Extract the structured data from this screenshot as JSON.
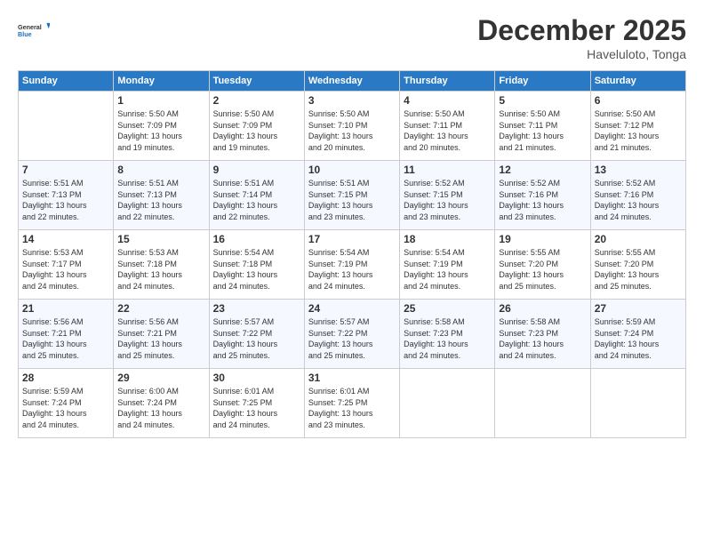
{
  "logo": {
    "text_general": "General",
    "text_blue": "Blue"
  },
  "header": {
    "month_year": "December 2025",
    "location": "Haveluloto, Tonga"
  },
  "days_of_week": [
    "Sunday",
    "Monday",
    "Tuesday",
    "Wednesday",
    "Thursday",
    "Friday",
    "Saturday"
  ],
  "weeks": [
    [
      {
        "day": "",
        "info": ""
      },
      {
        "day": "1",
        "info": "Sunrise: 5:50 AM\nSunset: 7:09 PM\nDaylight: 13 hours\nand 19 minutes."
      },
      {
        "day": "2",
        "info": "Sunrise: 5:50 AM\nSunset: 7:09 PM\nDaylight: 13 hours\nand 19 minutes."
      },
      {
        "day": "3",
        "info": "Sunrise: 5:50 AM\nSunset: 7:10 PM\nDaylight: 13 hours\nand 20 minutes."
      },
      {
        "day": "4",
        "info": "Sunrise: 5:50 AM\nSunset: 7:11 PM\nDaylight: 13 hours\nand 20 minutes."
      },
      {
        "day": "5",
        "info": "Sunrise: 5:50 AM\nSunset: 7:11 PM\nDaylight: 13 hours\nand 21 minutes."
      },
      {
        "day": "6",
        "info": "Sunrise: 5:50 AM\nSunset: 7:12 PM\nDaylight: 13 hours\nand 21 minutes."
      }
    ],
    [
      {
        "day": "7",
        "info": "Sunrise: 5:51 AM\nSunset: 7:13 PM\nDaylight: 13 hours\nand 22 minutes."
      },
      {
        "day": "8",
        "info": "Sunrise: 5:51 AM\nSunset: 7:13 PM\nDaylight: 13 hours\nand 22 minutes."
      },
      {
        "day": "9",
        "info": "Sunrise: 5:51 AM\nSunset: 7:14 PM\nDaylight: 13 hours\nand 22 minutes."
      },
      {
        "day": "10",
        "info": "Sunrise: 5:51 AM\nSunset: 7:15 PM\nDaylight: 13 hours\nand 23 minutes."
      },
      {
        "day": "11",
        "info": "Sunrise: 5:52 AM\nSunset: 7:15 PM\nDaylight: 13 hours\nand 23 minutes."
      },
      {
        "day": "12",
        "info": "Sunrise: 5:52 AM\nSunset: 7:16 PM\nDaylight: 13 hours\nand 23 minutes."
      },
      {
        "day": "13",
        "info": "Sunrise: 5:52 AM\nSunset: 7:16 PM\nDaylight: 13 hours\nand 24 minutes."
      }
    ],
    [
      {
        "day": "14",
        "info": "Sunrise: 5:53 AM\nSunset: 7:17 PM\nDaylight: 13 hours\nand 24 minutes."
      },
      {
        "day": "15",
        "info": "Sunrise: 5:53 AM\nSunset: 7:18 PM\nDaylight: 13 hours\nand 24 minutes."
      },
      {
        "day": "16",
        "info": "Sunrise: 5:54 AM\nSunset: 7:18 PM\nDaylight: 13 hours\nand 24 minutes."
      },
      {
        "day": "17",
        "info": "Sunrise: 5:54 AM\nSunset: 7:19 PM\nDaylight: 13 hours\nand 24 minutes."
      },
      {
        "day": "18",
        "info": "Sunrise: 5:54 AM\nSunset: 7:19 PM\nDaylight: 13 hours\nand 24 minutes."
      },
      {
        "day": "19",
        "info": "Sunrise: 5:55 AM\nSunset: 7:20 PM\nDaylight: 13 hours\nand 25 minutes."
      },
      {
        "day": "20",
        "info": "Sunrise: 5:55 AM\nSunset: 7:20 PM\nDaylight: 13 hours\nand 25 minutes."
      }
    ],
    [
      {
        "day": "21",
        "info": "Sunrise: 5:56 AM\nSunset: 7:21 PM\nDaylight: 13 hours\nand 25 minutes."
      },
      {
        "day": "22",
        "info": "Sunrise: 5:56 AM\nSunset: 7:21 PM\nDaylight: 13 hours\nand 25 minutes."
      },
      {
        "day": "23",
        "info": "Sunrise: 5:57 AM\nSunset: 7:22 PM\nDaylight: 13 hours\nand 25 minutes."
      },
      {
        "day": "24",
        "info": "Sunrise: 5:57 AM\nSunset: 7:22 PM\nDaylight: 13 hours\nand 25 minutes."
      },
      {
        "day": "25",
        "info": "Sunrise: 5:58 AM\nSunset: 7:23 PM\nDaylight: 13 hours\nand 24 minutes."
      },
      {
        "day": "26",
        "info": "Sunrise: 5:58 AM\nSunset: 7:23 PM\nDaylight: 13 hours\nand 24 minutes."
      },
      {
        "day": "27",
        "info": "Sunrise: 5:59 AM\nSunset: 7:24 PM\nDaylight: 13 hours\nand 24 minutes."
      }
    ],
    [
      {
        "day": "28",
        "info": "Sunrise: 5:59 AM\nSunset: 7:24 PM\nDaylight: 13 hours\nand 24 minutes."
      },
      {
        "day": "29",
        "info": "Sunrise: 6:00 AM\nSunset: 7:24 PM\nDaylight: 13 hours\nand 24 minutes."
      },
      {
        "day": "30",
        "info": "Sunrise: 6:01 AM\nSunset: 7:25 PM\nDaylight: 13 hours\nand 24 minutes."
      },
      {
        "day": "31",
        "info": "Sunrise: 6:01 AM\nSunset: 7:25 PM\nDaylight: 13 hours\nand 23 minutes."
      },
      {
        "day": "",
        "info": ""
      },
      {
        "day": "",
        "info": ""
      },
      {
        "day": "",
        "info": ""
      }
    ]
  ]
}
